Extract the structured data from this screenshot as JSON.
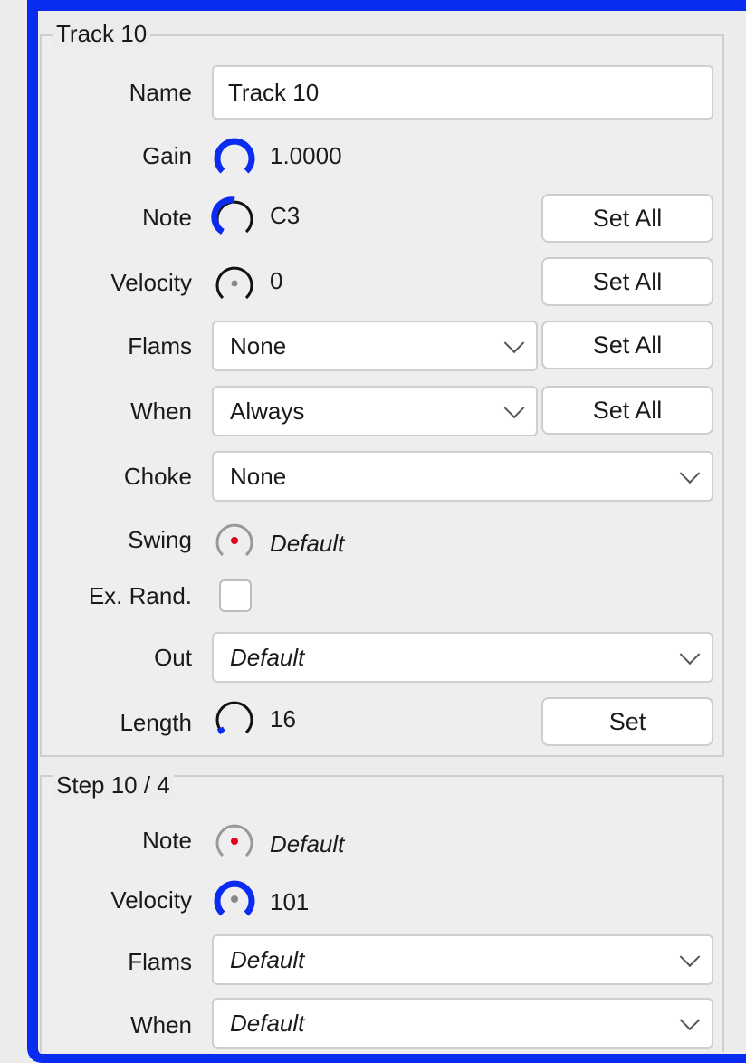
{
  "track": {
    "title": "Track 10",
    "name_label": "Name",
    "name_value": "Track 10",
    "gain": {
      "label": "Gain",
      "value": "1.0000"
    },
    "note": {
      "label": "Note",
      "value": "C3",
      "button": "Set All"
    },
    "velocity": {
      "label": "Velocity",
      "value": "0",
      "button": "Set All"
    },
    "flams": {
      "label": "Flams",
      "value": "None",
      "button": "Set All"
    },
    "when": {
      "label": "When",
      "value": "Always",
      "button": "Set All"
    },
    "choke": {
      "label": "Choke",
      "value": "None"
    },
    "swing": {
      "label": "Swing",
      "value": "Default"
    },
    "ex_rand": {
      "label": "Ex. Rand.",
      "checked": false
    },
    "out": {
      "label": "Out",
      "value": "Default"
    },
    "length": {
      "label": "Length",
      "value": "16",
      "button": "Set"
    }
  },
  "step": {
    "title": "Step 10 / 4",
    "note": {
      "label": "Note",
      "value": "Default"
    },
    "velocity": {
      "label": "Velocity",
      "value": "101"
    },
    "flams": {
      "label": "Flams",
      "value": "Default"
    },
    "when": {
      "label": "When",
      "value": "Default"
    }
  },
  "colors": {
    "accent": "#0a2cf0",
    "dot_red": "#e0001b"
  }
}
